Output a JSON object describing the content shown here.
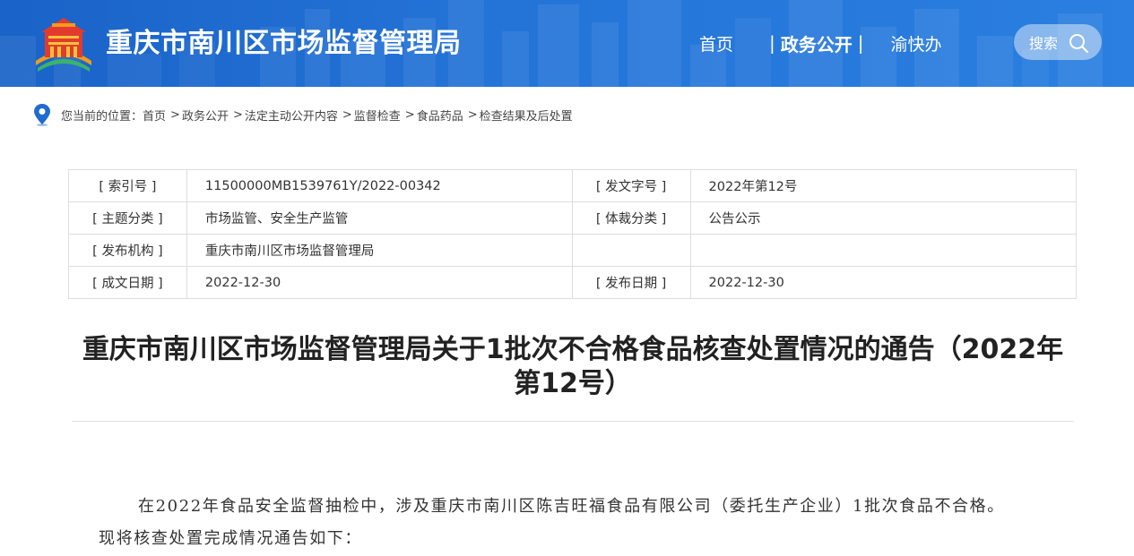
{
  "header": {
    "site_title": "重庆市南川区市场监督管理局",
    "nav": {
      "home": "首页",
      "separator": "|",
      "active": "政务公开",
      "yukuaiban": "渝快办"
    },
    "search_label": "搜索"
  },
  "breadcrumb": {
    "prefix": "您当前的位置：",
    "separator": ">",
    "items": [
      "首页",
      "政务公开",
      "法定主动公开内容",
      "监督检查",
      "食品药品",
      "检查结果及后处置"
    ]
  },
  "meta": {
    "rows": [
      {
        "l1": "[ 索引号 ]",
        "v1": "11500000MB1539761Y/2022-00342",
        "l2": "[ 发文字号 ]",
        "v2": "2022年第12号"
      },
      {
        "l1": "[ 主题分类 ]",
        "v1": "市场监管、安全生产监管",
        "l2": "[ 体裁分类 ]",
        "v2": "公告公示"
      },
      {
        "l1": "[ 发布机构 ]",
        "v1": "重庆市南川区市场监督管理局",
        "l2": "",
        "v2": ""
      },
      {
        "l1": "[ 成文日期 ]",
        "v1": "2022-12-30",
        "l2": "[ 发布日期 ]",
        "v2": "2022-12-30"
      }
    ]
  },
  "article": {
    "title": "重庆市南川区市场监督管理局关于1批次不合格食品核查处置情况的通告（2022年第12号）",
    "paragraph": "在2022年食品安全监督抽检中，涉及重庆市南川区陈吉旺福食品有限公司（委托生产企业）1批次食品不合格。现将核查处置完成情况通告如下："
  },
  "colors": {
    "header_blue": "#1f6bd0",
    "logo_red": "#e23b2e",
    "logo_orange": "#f39a1e",
    "logo_green": "#3bb36a"
  },
  "icons": [
    "emblem-logo-icon",
    "search-icon",
    "location-pin-icon"
  ]
}
